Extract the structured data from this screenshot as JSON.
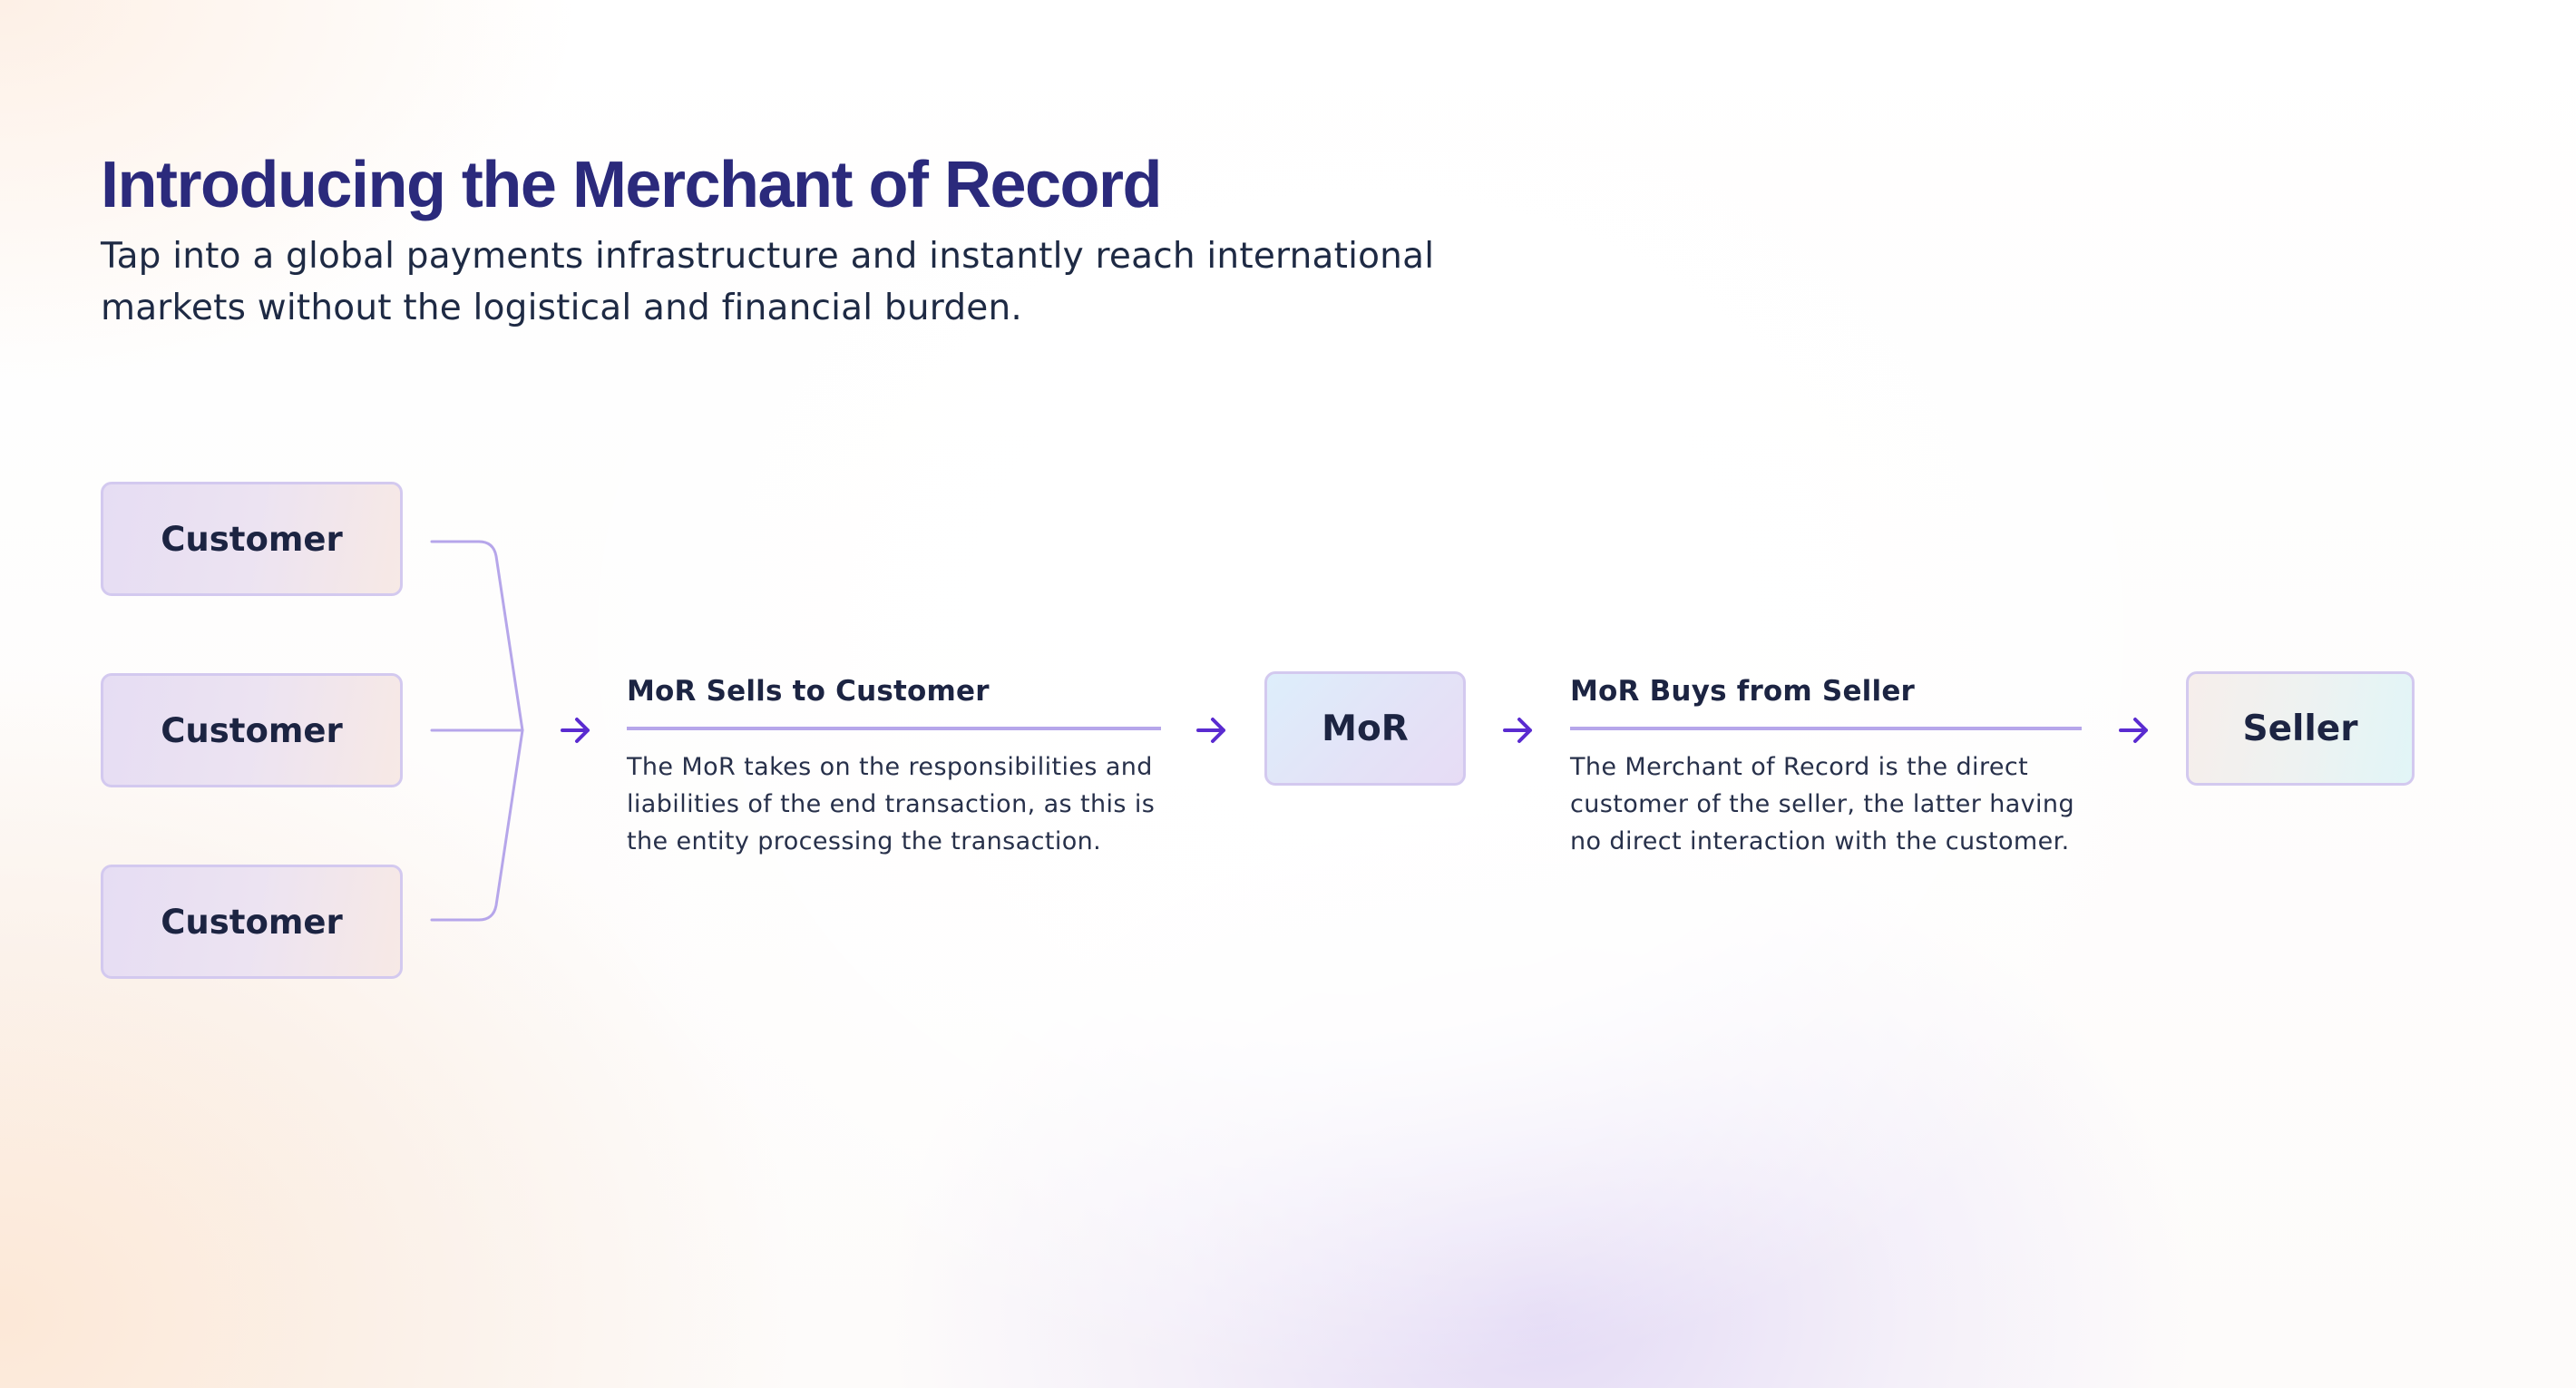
{
  "header": {
    "title": "Introducing the Merchant of Record",
    "subtitle": "Tap into a global payments infrastructure and instantly reach international markets without the logistical and financial burden."
  },
  "diagram": {
    "customers": [
      {
        "label": "Customer"
      },
      {
        "label": "Customer"
      },
      {
        "label": "Customer"
      }
    ],
    "mor_label": "MoR",
    "seller_label": "Seller",
    "step_sells": {
      "title": "MoR Sells to Customer",
      "description": "The MoR takes on the responsibilities and liabilities of the end transaction, as this is the entity processing the transaction."
    },
    "step_buys": {
      "title": "MoR Buys from Seller",
      "description": "The Merchant of Record is the direct customer of the seller, the latter having no direct interaction with the customer."
    }
  },
  "colors": {
    "title": "#2b2a7c",
    "text": "#1c2442",
    "node_border": "#d3c9ef",
    "connector": "#b6a6ea",
    "arrow": "#5a2bd0"
  },
  "icons": {
    "flow_arrow": "arrow-right-icon"
  }
}
